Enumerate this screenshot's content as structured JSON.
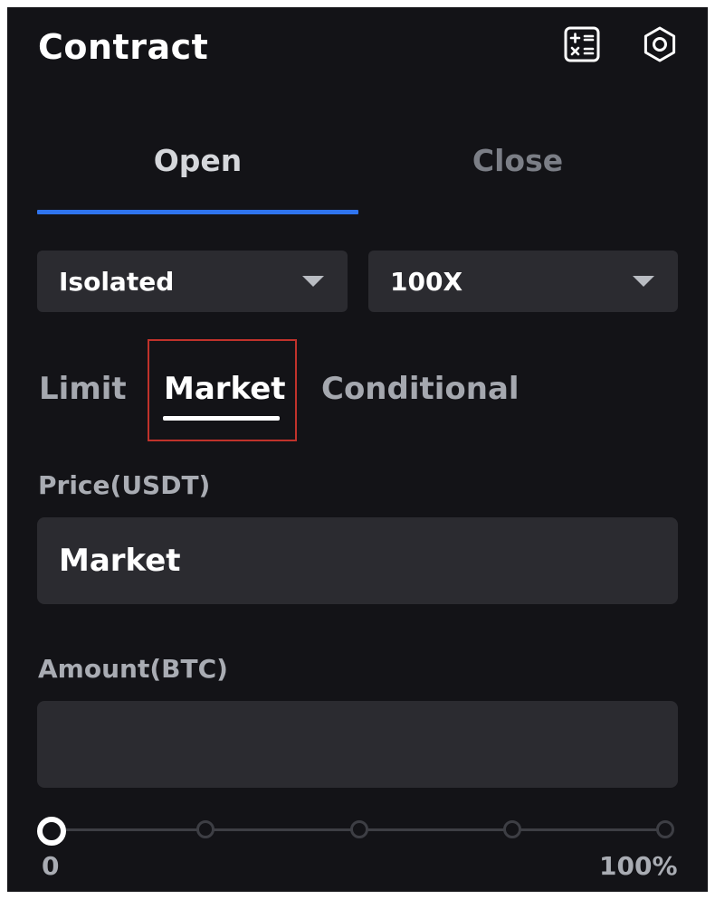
{
  "header": {
    "title": "Contract",
    "icons": [
      "calculator-icon",
      "settings-icon"
    ]
  },
  "tabs": [
    {
      "label": "Open",
      "active": true
    },
    {
      "label": "Close",
      "active": false
    }
  ],
  "selectors": {
    "margin_mode": "Isolated",
    "leverage": "100X"
  },
  "order_types": [
    {
      "label": "Limit",
      "active": false
    },
    {
      "label": "Market",
      "active": true
    },
    {
      "label": "Conditional",
      "active": false
    }
  ],
  "price": {
    "label": "Price(USDT)",
    "value": "Market"
  },
  "amount": {
    "label": "Amount(BTC)",
    "value": ""
  },
  "slider": {
    "min_label": "0",
    "max_label": "100%",
    "value_percent": 0,
    "stops_percent": [
      0,
      25,
      50,
      75,
      100
    ]
  },
  "colors": {
    "background": "#131317",
    "accent": "#2f74ee",
    "field": "#2b2b30",
    "highlight": "#c0322b"
  }
}
